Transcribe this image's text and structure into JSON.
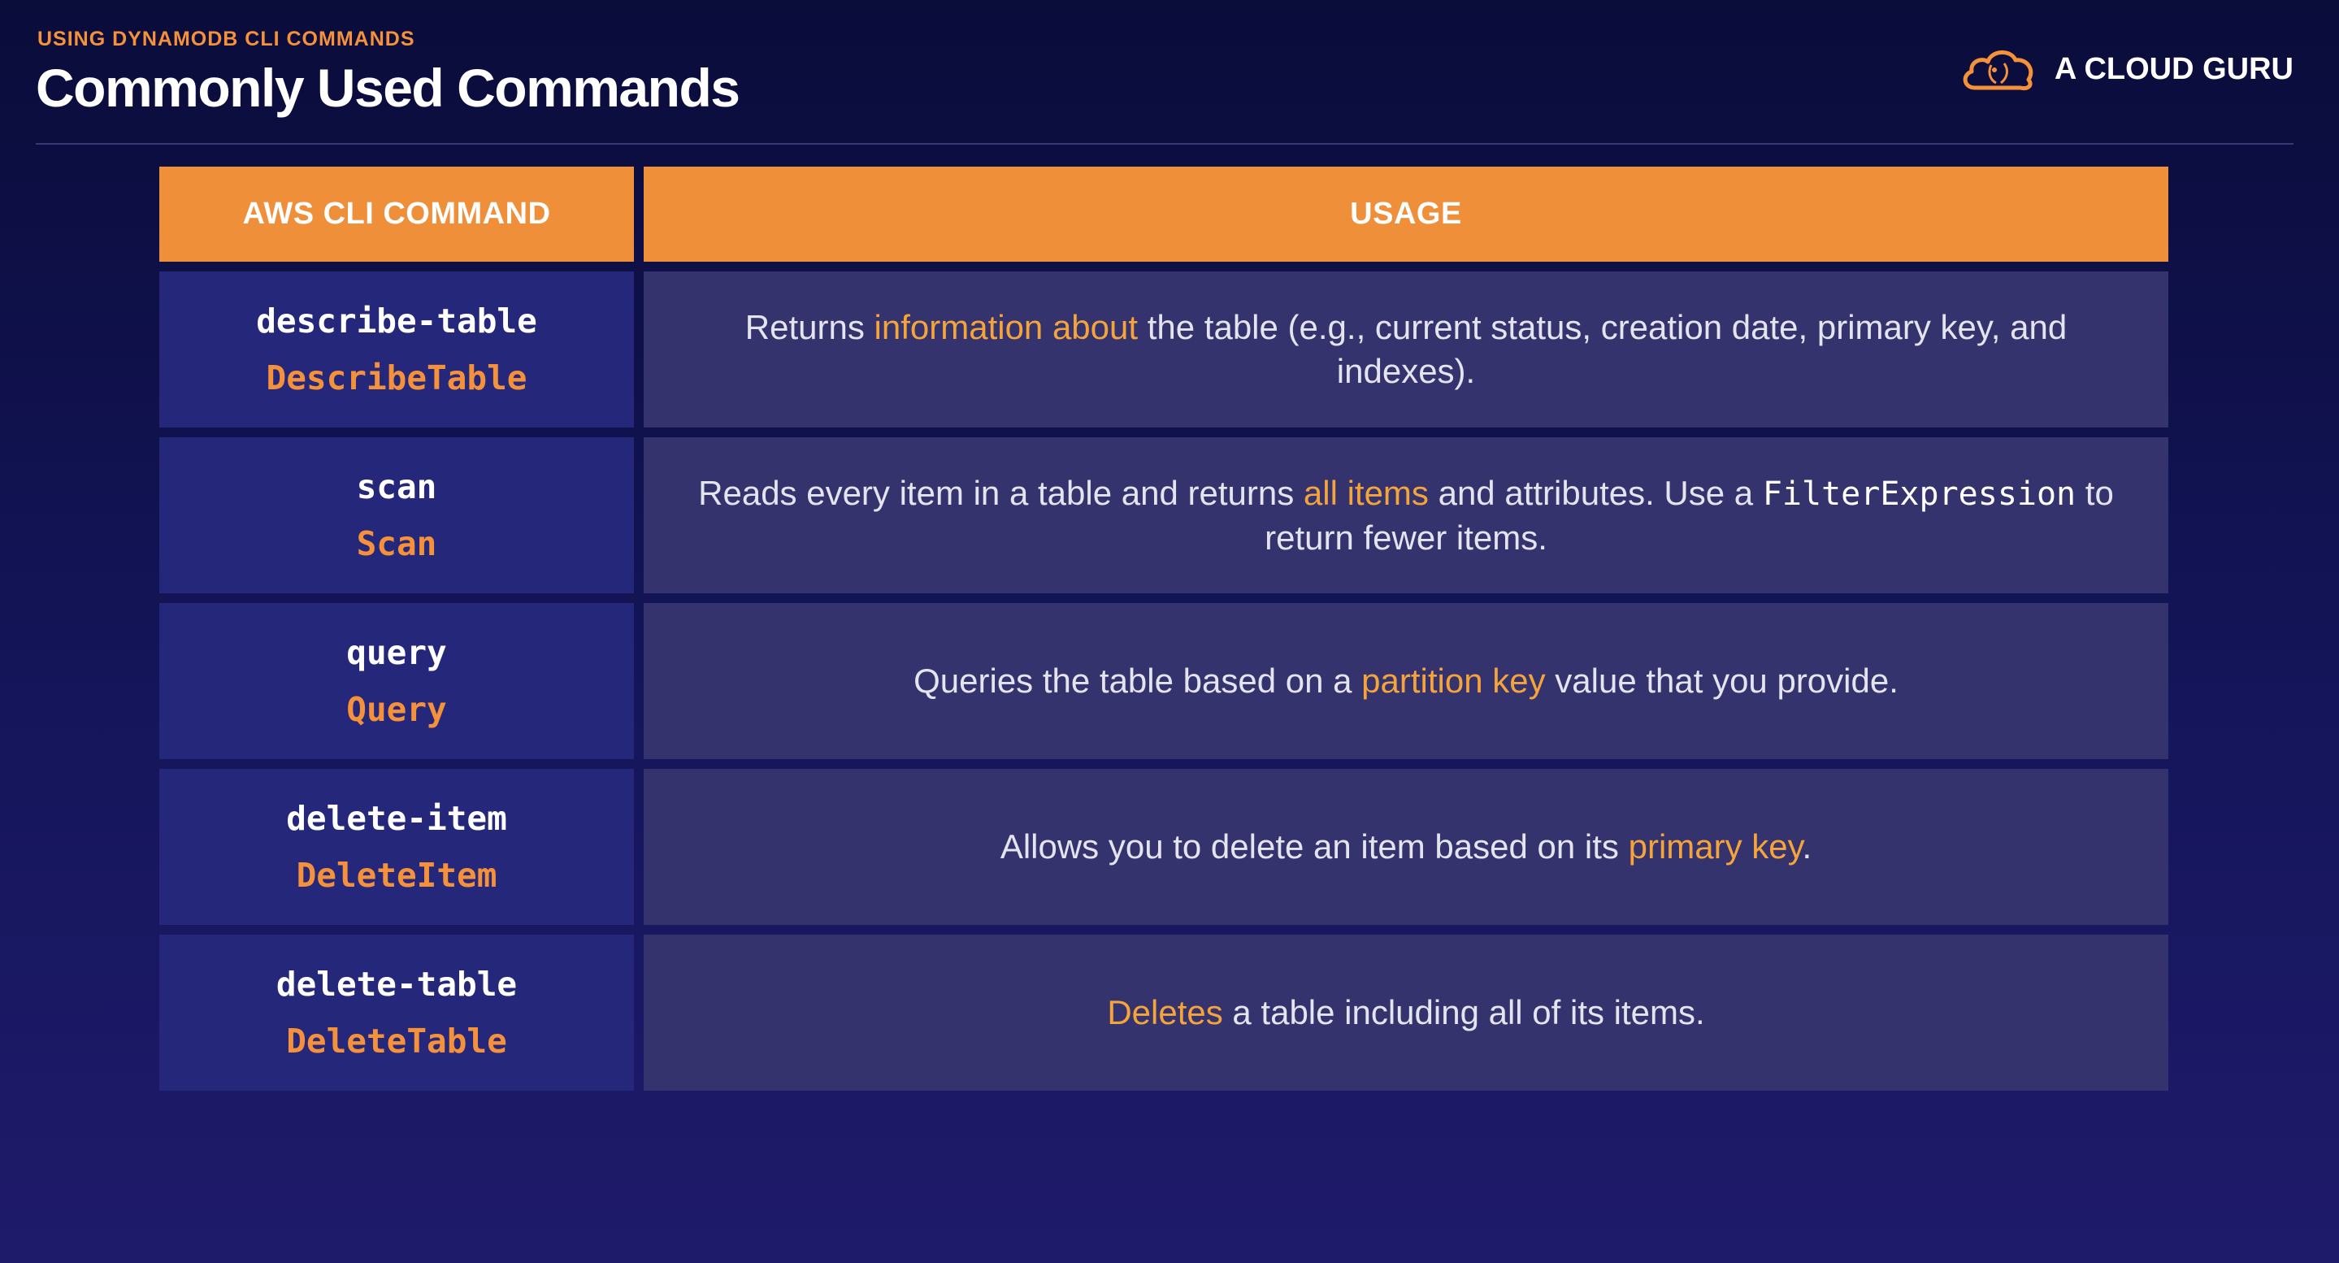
{
  "header": {
    "subtitle": "USING DYNAMODB CLI COMMANDS",
    "title": "Commonly Used Commands",
    "brand": "A CLOUD GURU",
    "brand_icon": "cloud-logo-icon"
  },
  "colors": {
    "accent": "#f5913b",
    "background": "#0f1148",
    "header_cell": "#ef8f3a",
    "command_cell": "#25287a",
    "usage_cell": "#35336d"
  },
  "table": {
    "columns": [
      "AWS CLI COMMAND",
      "USAGE"
    ],
    "rows": [
      {
        "cli": "describe-table",
        "api": "DescribeTable",
        "usage": [
          {
            "t": "Returns "
          },
          {
            "t": "information about",
            "hl": true
          },
          {
            "t": " the table (e.g., current status, creation date, primary key, and indexes)."
          }
        ]
      },
      {
        "cli": "scan",
        "api": "Scan",
        "usage": [
          {
            "t": "Reads every item in a table and returns "
          },
          {
            "t": "all items",
            "hl": true
          },
          {
            "t": " and attributes. Use a "
          },
          {
            "t": "FilterExpression",
            "code": true
          },
          {
            "t": " to return fewer items."
          }
        ]
      },
      {
        "cli": "query",
        "api": "Query",
        "usage": [
          {
            "t": "Queries the table based on a "
          },
          {
            "t": "partition key",
            "hl": true
          },
          {
            "t": " value that you provide."
          }
        ]
      },
      {
        "cli": "delete-item",
        "api": "DeleteItem",
        "usage": [
          {
            "t": "Allows you to delete an item based on its "
          },
          {
            "t": "primary key",
            "hl": true
          },
          {
            "t": "."
          }
        ]
      },
      {
        "cli": "delete-table",
        "api": "DeleteTable",
        "usage": [
          {
            "t": "Deletes",
            "hl": true
          },
          {
            "t": " a table including all of its items."
          }
        ]
      }
    ]
  }
}
